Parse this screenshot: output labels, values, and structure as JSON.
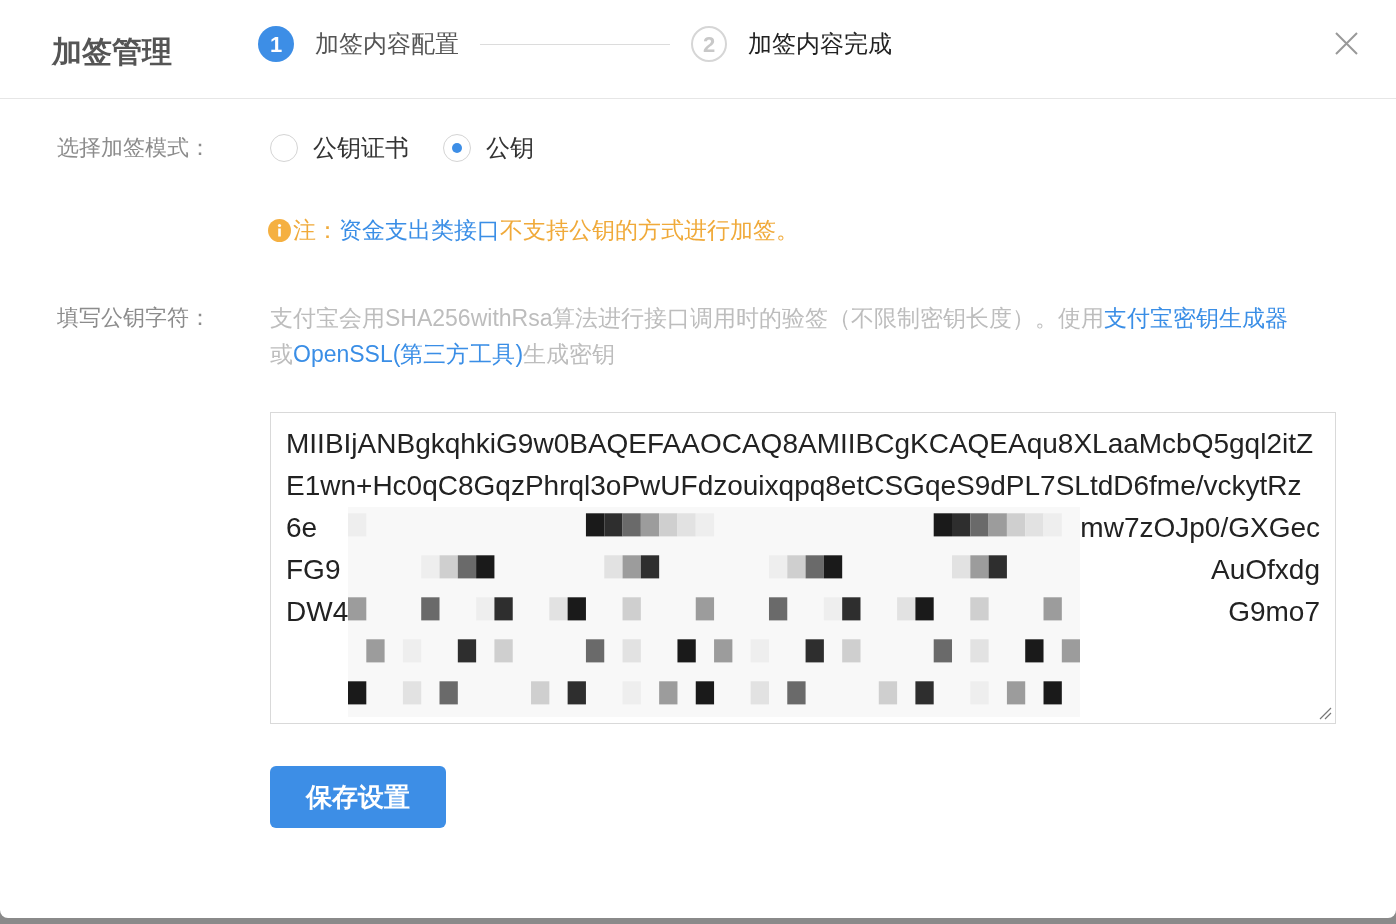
{
  "dialog": {
    "title": "加签管理",
    "steps": [
      {
        "number": "1",
        "label": "加签内容配置",
        "selected": true
      },
      {
        "number": "2",
        "label": "加签内容完成",
        "selected": false
      }
    ]
  },
  "sign_mode": {
    "label": "选择加签模式：",
    "options": [
      {
        "label": "公钥证书",
        "selected": false
      },
      {
        "label": "公钥",
        "selected": true
      }
    ]
  },
  "note": {
    "prefix": "注：",
    "link": "资金支出类接口",
    "suffix": "不支持公钥的方式进行加签。"
  },
  "public_key": {
    "label": "填写公钥字符：",
    "help_lines": [
      [
        {
          "kind": "text",
          "text": "支付宝会用SHA256withRsa算法进行接口调用时的验签（不限制密钥长度）。使用"
        },
        {
          "kind": "link",
          "text": "支付宝密钥生成器"
        }
      ],
      [
        {
          "kind": "text",
          "text": "或"
        },
        {
          "kind": "link",
          "text": "OpenSSL(第三方工具)"
        },
        {
          "kind": "text",
          "text": "生成密钥"
        }
      ]
    ],
    "value_lines": [
      {
        "kind": "full",
        "text": "MIIBIjANBgkqhkiG9w0BAQEFAAOCAQ8AMIIBCgKCAQEAqu8XLaaMcbQ5gql2itZ"
      },
      {
        "kind": "full",
        "text": "E1wn+Hc0qC8GqzPhrql3oPwUFdzouixqpq8etCSGqeS9dPL7SLtdD6fme/vckytRz"
      },
      {
        "kind": "partial",
        "start": "6e",
        "end": "mw7zOJp0/GXGec"
      },
      {
        "kind": "partial",
        "start": "FG9",
        "end": "AuOfxdg"
      },
      {
        "kind": "partial",
        "start": "DW4",
        "end": "G9mo7"
      }
    ]
  },
  "save_button": {
    "label": "保存设置"
  }
}
